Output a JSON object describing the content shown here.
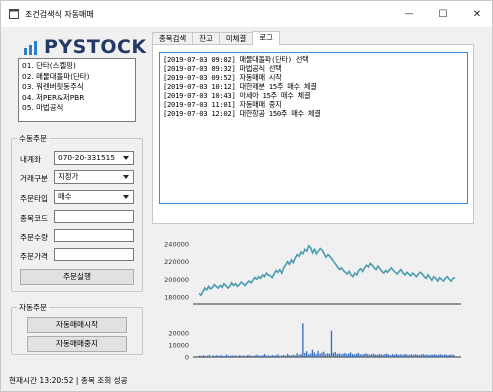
{
  "window": {
    "title": "조건검색식 자동매매",
    "minimize_symbol": "—",
    "maximize_symbol": "☐",
    "close_symbol": "✕"
  },
  "logo": {
    "text": "PYSTOCK"
  },
  "strategies": [
    "01. 단타(스켈핑)",
    "02. 매물대돌파(단타)",
    "03. 워렌버핏동주식",
    "04. 저PER&저PBR",
    "05. 마법공식"
  ],
  "manual_order": {
    "group_title": "수동주문",
    "account_label": "내계좌",
    "account_value": "070-20-331515",
    "order_type_label": "거래구분",
    "order_type_value": "지정가",
    "order_kind_label": "주문타입",
    "order_kind_value": "매수",
    "code_label": "종목코드",
    "quantity_label": "주문수량",
    "price_label": "주문가격",
    "submit_label": "주문실행"
  },
  "auto_order": {
    "group_title": "자동주문",
    "start_label": "자동매매시작",
    "stop_label": "자동매매중지"
  },
  "tabs": [
    "종목검색",
    "잔고",
    "미체결",
    "로그"
  ],
  "active_tab": 3,
  "log_lines": [
    "[2019-07-03 09:02] 매물대돌파(단타) 선택",
    "[2019-07-03 09:32] 마법공식 선택",
    "[2019-07-03 09:52] 자동매매 시작",
    "[2019-07-03 10:12] 대한제분 15주 매수 체결",
    "[2019-07-03 10:43] 아세아 15주 매수 체결",
    "[2019-07-03 11:01] 자동매매 중지",
    "[2019-07-03 12:02] 대한항공 150주 매수 체결"
  ],
  "status_bar": "현재시간 13:20:52 | 종목 조회 성공",
  "colors": {
    "line": "#4a9bb0",
    "volume": "#3a6fb8",
    "log_border": "#3a8ad6",
    "logo": "#243a66"
  },
  "chart_data": [
    {
      "type": "line",
      "yticks": [
        180000,
        200000,
        220000,
        240000
      ],
      "ylim": [
        172000,
        248000
      ],
      "values": [
        184000,
        182000,
        186000,
        190000,
        188000,
        192000,
        189000,
        191000,
        194000,
        192000,
        190000,
        193000,
        191000,
        195000,
        193000,
        190000,
        192000,
        196000,
        193000,
        195000,
        192000,
        194000,
        197000,
        195000,
        193000,
        196000,
        198000,
        196000,
        199000,
        202000,
        200000,
        203000,
        201000,
        205000,
        203000,
        207000,
        205000,
        204000,
        202000,
        206000,
        210000,
        208000,
        211000,
        207000,
        213000,
        216000,
        220000,
        217000,
        222000,
        219000,
        224000,
        228000,
        226000,
        231000,
        229000,
        234000,
        232000,
        238000,
        236000,
        230000,
        234000,
        229000,
        232000,
        235000,
        233000,
        229000,
        225000,
        228000,
        226000,
        223000,
        220000,
        217000,
        214000,
        211000,
        213000,
        210000,
        208000,
        206000,
        209000,
        205000,
        203000,
        207000,
        205000,
        210000,
        212000,
        209000,
        213000,
        216000,
        214000,
        218000,
        216000,
        213000,
        211000,
        215000,
        212000,
        209000,
        207000,
        210000,
        208000,
        211000,
        213000,
        210000,
        208000,
        206000,
        209000,
        211000,
        207000,
        205000,
        208000,
        206000,
        204000,
        207000,
        205000,
        203000,
        206000,
        208000,
        206000,
        203000,
        201000,
        205000,
        202000,
        199000,
        203000,
        201000,
        198000,
        202000,
        200000,
        198000,
        201000,
        203000,
        200000,
        198000,
        201000,
        202000
      ]
    },
    {
      "type": "bar",
      "yticks": [
        10000,
        20000
      ],
      "ylim": [
        0,
        30000
      ],
      "values": [
        1200,
        800,
        1500,
        900,
        1100,
        1800,
        700,
        1300,
        1000,
        1600,
        900,
        1400,
        1100,
        800,
        2000,
        1200,
        900,
        1500,
        1100,
        1300,
        800,
        1700,
        1000,
        1200,
        900,
        1400,
        1600,
        1100,
        900,
        1300,
        1800,
        1200,
        1000,
        1500,
        2400,
        1100,
        1300,
        900,
        1600,
        1200,
        1400,
        2200,
        1000,
        1300,
        1700,
        1100,
        2600,
        1500,
        1200,
        1900,
        1300,
        3200,
        1800,
        2500,
        28000,
        3400,
        4800,
        2100,
        2900,
        6200,
        3800,
        2400,
        5200,
        2800,
        3600,
        4400,
        2300,
        3100,
        2700,
        22000,
        3500,
        4100,
        2600,
        3000,
        2200,
        2700,
        3300,
        2400,
        2900,
        3800,
        2500,
        2100,
        2700,
        3400,
        2300,
        2000,
        2600,
        3100,
        2400,
        1900,
        2300,
        2800,
        2100,
        1800,
        2500,
        2200,
        1900,
        2400,
        2800,
        2000,
        1700,
        2300,
        2000,
        2600,
        1800,
        2200,
        1900,
        2100,
        2500,
        1700,
        2000,
        2300,
        1800,
        2200,
        1900,
        1600,
        2100,
        2400,
        1800,
        2000,
        1700,
        2200,
        1900,
        2300,
        1700,
        2000,
        2200,
        1800,
        1900,
        2100,
        1700,
        2000,
        1800,
        1900
      ]
    }
  ]
}
